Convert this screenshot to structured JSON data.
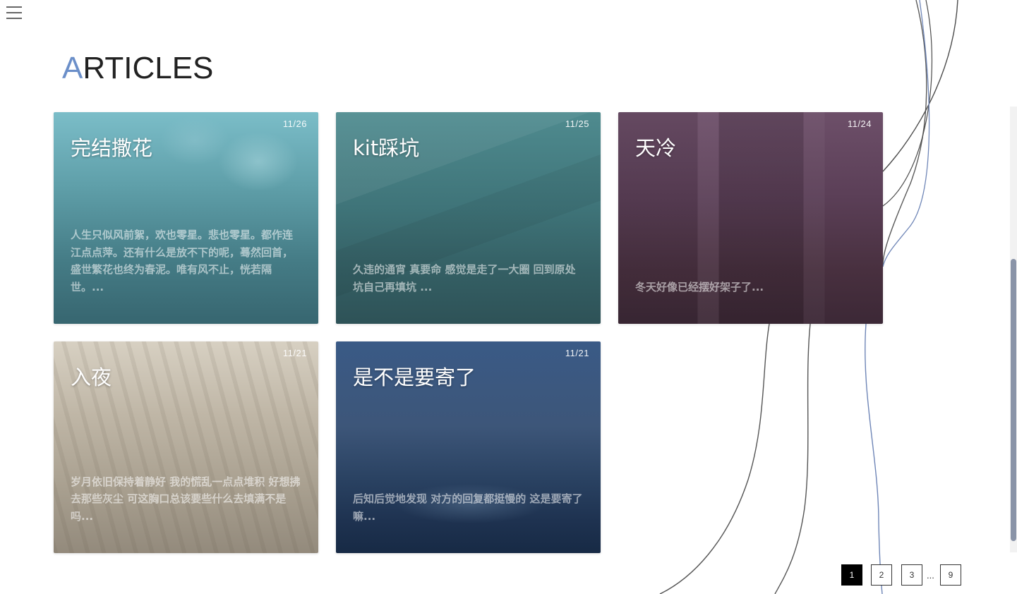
{
  "menu": {
    "icon": "hamburger-menu-icon"
  },
  "header": {
    "title_first": "A",
    "title_rest": "RTICLES"
  },
  "colors": {
    "accent": "#6b8fc9",
    "active_page": "#000000"
  },
  "articles": [
    {
      "date": "11/26",
      "title": "完结撒花",
      "excerpt": "人生只似风前絮，欢也零星。悲也零星。都作连江点点萍。还有什么是放不下的呢，蓦然回首，盛世繁花也终为春泥。唯有风不止，恍若隔世。..."
    },
    {
      "date": "11/25",
      "title": "kit踩坑",
      "excerpt": "久违的通宵 真要命 感觉是走了一大圈 回到原处 坑自己再填坑 ..."
    },
    {
      "date": "11/24",
      "title": "天冷",
      "excerpt": "冬天好像已经摆好架子了..."
    },
    {
      "date": "11/21",
      "title": "入夜",
      "excerpt": "岁月依旧保持着静好 我的慌乱一点点堆积 好想拂去那些灰尘 可这胸口总该要些什么去填满不是吗..."
    },
    {
      "date": "11/21",
      "title": "是不是要寄了",
      "excerpt": "后知后觉地发现 对方的回复都挺慢的 这是要寄了嘛..."
    }
  ],
  "pagination": {
    "pages": [
      "1",
      "2",
      "3",
      "9"
    ],
    "current": "1",
    "ellipsis": "..."
  }
}
